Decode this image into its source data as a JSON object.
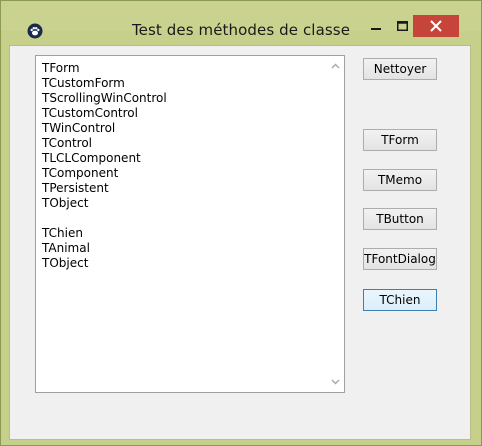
{
  "window": {
    "title": "Test des méthodes de classe"
  },
  "listbox": {
    "lines": [
      "TForm",
      "TCustomForm",
      "TScrollingWinControl",
      "TCustomControl",
      "TWinControl",
      "TControl",
      "TLCLComponent",
      "TComponent",
      "TPersistent",
      "TObject",
      "",
      "TChien",
      "TAnimal",
      "TObject"
    ]
  },
  "buttons": {
    "nettoyer": "Nettoyer",
    "tform": "TForm",
    "tmemo": "TMemo",
    "tbutton": "TButton",
    "tfontdialog": "TFontDialog",
    "tchien": "TChien"
  },
  "icons": {
    "app": "paw-icon",
    "minimize": "minimize-icon",
    "maximize": "maximize-icon",
    "close": "close-icon",
    "scroll_up": "scroll-up-icon",
    "scroll_down": "scroll-down-icon"
  },
  "colors": {
    "close_button": "#c7443a",
    "focused_button_border": "#3c7fb1"
  }
}
